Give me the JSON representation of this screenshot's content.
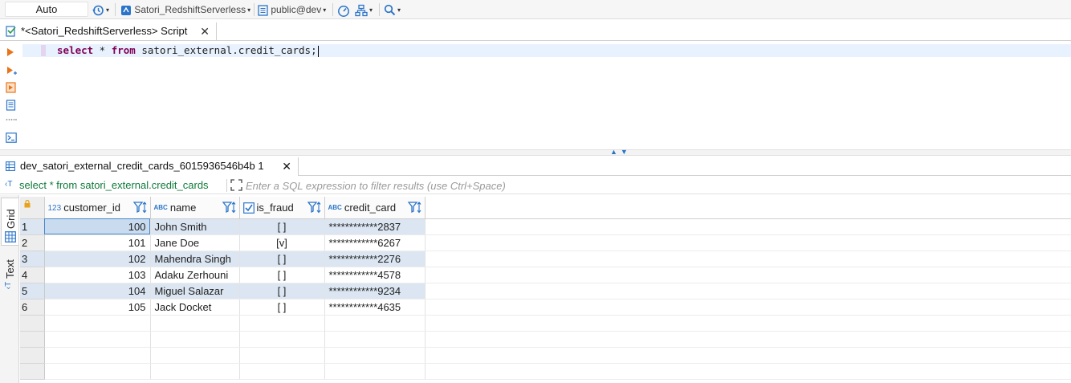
{
  "toolbar": {
    "transaction_mode": "Auto",
    "datasource": "Satori_RedshiftServerless",
    "schema": "public@dev"
  },
  "editor": {
    "tab_title": "*<Satori_RedshiftServerless> Script",
    "sql": {
      "kw_select": "select",
      "star": " * ",
      "kw_from": "from",
      "table": " satori_external.credit_cards;"
    }
  },
  "results": {
    "tab_title": "dev_satori_external_credit_cards_6015936546b4b 1",
    "query_text": "select * from satori_external.credit_cards",
    "filter_placeholder": "Enter a SQL expression to filter results (use Ctrl+Space)",
    "side_tabs": {
      "grid": "Grid",
      "text": "Text"
    },
    "columns": [
      {
        "name": "customer_id",
        "type": "123"
      },
      {
        "name": "name",
        "type": "ABC"
      },
      {
        "name": "is_fraud",
        "type": "bool"
      },
      {
        "name": "credit_card",
        "type": "ABC"
      }
    ],
    "rows": [
      {
        "n": "1",
        "customer_id": "100",
        "name": "John Smith",
        "is_fraud": "[ ]",
        "credit_card": "************2837"
      },
      {
        "n": "2",
        "customer_id": "101",
        "name": "Jane Doe",
        "is_fraud": "[v]",
        "credit_card": "************6267"
      },
      {
        "n": "3",
        "customer_id": "102",
        "name": "Mahendra Singh",
        "is_fraud": "[ ]",
        "credit_card": "************2276"
      },
      {
        "n": "4",
        "customer_id": "103",
        "name": "Adaku Zerhouni",
        "is_fraud": "[ ]",
        "credit_card": "************4578"
      },
      {
        "n": "5",
        "customer_id": "104",
        "name": "Miguel Salazar",
        "is_fraud": "[ ]",
        "credit_card": "************9234"
      },
      {
        "n": "6",
        "customer_id": "105",
        "name": "Jack Docket",
        "is_fraud": "[ ]",
        "credit_card": "************4635"
      }
    ]
  },
  "colors": {
    "accent": "#2a74c9",
    "keyword": "#7f0055",
    "row_alt": "#dbe6f2",
    "query_green": "#0f7b3a"
  }
}
